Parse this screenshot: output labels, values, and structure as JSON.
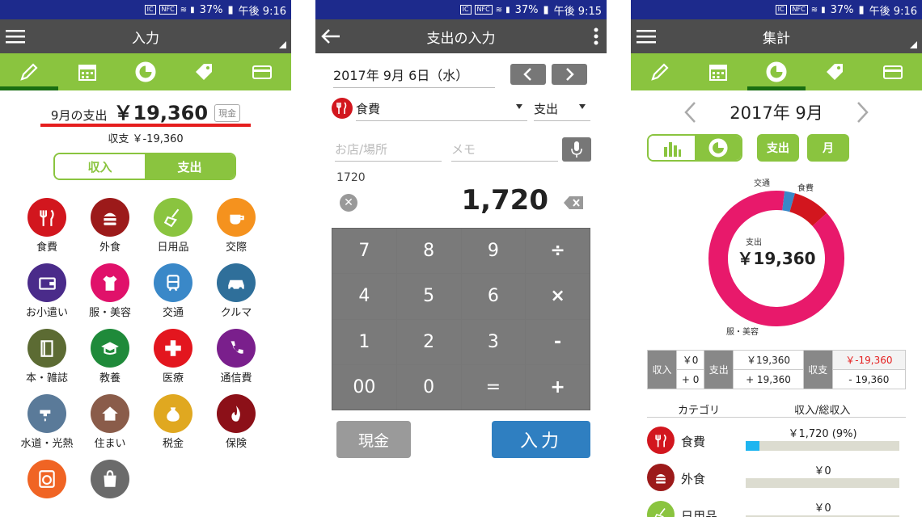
{
  "status": {
    "battery": "37%",
    "time1": "午後 9:16",
    "time2": "午後 9:15",
    "time3": "午後 9:16"
  },
  "screen1": {
    "title": "入力",
    "summary_label": "9月の支出",
    "summary_amount": "￥19,360",
    "cash_badge": "現金",
    "balance": "収支 ￥-19,360",
    "toggle": {
      "income": "収入",
      "expense": "支出"
    },
    "categories": [
      {
        "label": "食費",
        "color": "#d2161e",
        "icon": "fork-knife-icon"
      },
      {
        "label": "外食",
        "color": "#9c1a1a",
        "icon": "burger-icon"
      },
      {
        "label": "日用品",
        "color": "#8ac43f",
        "icon": "broom-icon"
      },
      {
        "label": "交際",
        "color": "#f5921e",
        "icon": "cup-icon"
      },
      {
        "label": "お小遣い",
        "color": "#4a2b8a",
        "icon": "wallet-icon"
      },
      {
        "label": "服・美容",
        "color": "#e0116a",
        "icon": "shirt-icon"
      },
      {
        "label": "交通",
        "color": "#3a88c8",
        "icon": "train-icon"
      },
      {
        "label": "クルマ",
        "color": "#2f6f9a",
        "icon": "car-icon"
      },
      {
        "label": "本・雑誌",
        "color": "#5c6b33",
        "icon": "book-icon"
      },
      {
        "label": "教養",
        "color": "#1f8a3a",
        "icon": "graduation-cap-icon"
      },
      {
        "label": "医療",
        "color": "#e3161e",
        "icon": "medical-cross-icon"
      },
      {
        "label": "通信費",
        "color": "#7a1f8c",
        "icon": "phone-icon"
      },
      {
        "label": "水道・光熱",
        "color": "#5a7a99",
        "icon": "faucet-icon"
      },
      {
        "label": "住まい",
        "color": "#8a5c4a",
        "icon": "house-icon"
      },
      {
        "label": "税金",
        "color": "#e0a820",
        "icon": "money-bag-icon"
      },
      {
        "label": "保険",
        "color": "#8c1018",
        "icon": "flame-icon"
      },
      {
        "label": "",
        "color": "#f06424",
        "icon": "washer-icon"
      },
      {
        "label": "",
        "color": "#6b6b6b",
        "icon": "shopping-bag-icon"
      }
    ]
  },
  "screen2": {
    "title": "支出の入力",
    "date": "2017年 9月 6日（水）",
    "category": "食費",
    "type": "支出",
    "shop_placeholder": "お店/場所",
    "memo_placeholder": "メモ",
    "expression": "1720",
    "amount": "1,720",
    "keys": [
      "7",
      "8",
      "9",
      "÷",
      "4",
      "5",
      "6",
      "×",
      "1",
      "2",
      "3",
      "-",
      "00",
      "0",
      "=",
      "+"
    ],
    "cash_button": "現金",
    "enter_button": "入力"
  },
  "screen3": {
    "title": "集計",
    "month": "2017年 9月",
    "pill_expense": "支出",
    "pill_month": "月",
    "donut": {
      "center_label": "支出",
      "center_amount": "￥19,360",
      "label_traffic": "交通",
      "label_food": "食費",
      "label_clothes": "服・美容",
      "segments": [
        {
          "name": "交通",
          "value": 0.025,
          "color": "#3a88c8"
        },
        {
          "name": "食費",
          "value": 0.089,
          "color": "#d2161e"
        },
        {
          "name": "服・美容",
          "value": 0.886,
          "color": "#e8196b"
        }
      ]
    },
    "table": {
      "income_h": "収入",
      "income_v": "￥0",
      "income_d": "+ 0",
      "expense_h": "支出",
      "expense_v": "￥19,360",
      "expense_d": "+ 19,360",
      "balance_h": "収支",
      "balance_v": "￥-19,360",
      "balance_d": "- 19,360"
    },
    "list_head": {
      "category": "カテゴリ",
      "ratio": "収入/総収入"
    },
    "rows": [
      {
        "name": "食費",
        "value": "￥1,720 (9%)",
        "pct": 0.09,
        "color": "#d2161e"
      },
      {
        "name": "外食",
        "value": "￥0",
        "pct": 0,
        "color": "#9c1a1a"
      },
      {
        "name": "日用品",
        "value": "￥0",
        "pct": 0,
        "color": "#8ac43f"
      }
    ]
  }
}
